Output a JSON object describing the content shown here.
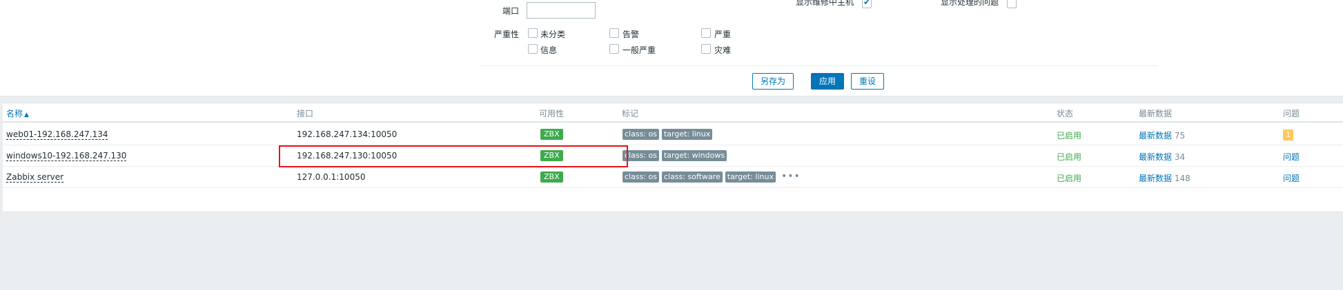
{
  "filter": {
    "top_option_left": "显示维修中主机",
    "top_option_right": "显示处理的问题",
    "port_label": "端口",
    "severity_label": "严重性",
    "severities": [
      "未分类",
      "告警",
      "严重",
      "信息",
      "一般严重",
      "灾难"
    ],
    "buttons": {
      "save_as": "另存为",
      "apply": "应用",
      "reset": "重设"
    }
  },
  "table": {
    "headers": {
      "name": "名称",
      "sort_icon": "▲",
      "interface": "接口",
      "availability": "可用性",
      "tags": "标记",
      "status": "状态",
      "latest_data": "最新数据",
      "problems": "问题"
    },
    "rows": [
      {
        "name": "web01-192.168.247.134",
        "interface": "192.168.247.134:10050",
        "availability": "ZBX",
        "tags": [
          "class: os",
          "target: linux"
        ],
        "status": "已启用",
        "latest_data_label": "最新数据",
        "latest_data_count": "75",
        "problem_count": "1"
      },
      {
        "name": "windows10-192.168.247.130",
        "interface": "192.168.247.130:10050",
        "availability": "ZBX",
        "tags": [
          "class: os",
          "target: windows"
        ],
        "status": "已启用",
        "latest_data_label": "最新数据",
        "latest_data_count": "34",
        "problem_label": "问题"
      },
      {
        "name": "Zabbix server",
        "interface": "127.0.0.1:10050",
        "availability": "ZBX",
        "tags": [
          "class: os",
          "class: software",
          "target: linux"
        ],
        "more_icon": "•••",
        "status": "已启用",
        "latest_data_label": "最新数据",
        "latest_data_count": "148",
        "problem_label": "问题"
      }
    ]
  },
  "colors": {
    "link": "#0275b8",
    "enabled": "#3daa4d",
    "zbx_available": "#3daa4d",
    "tag": "#768d99",
    "problem_warning": "#ffc859",
    "highlight": "#e8121a"
  }
}
